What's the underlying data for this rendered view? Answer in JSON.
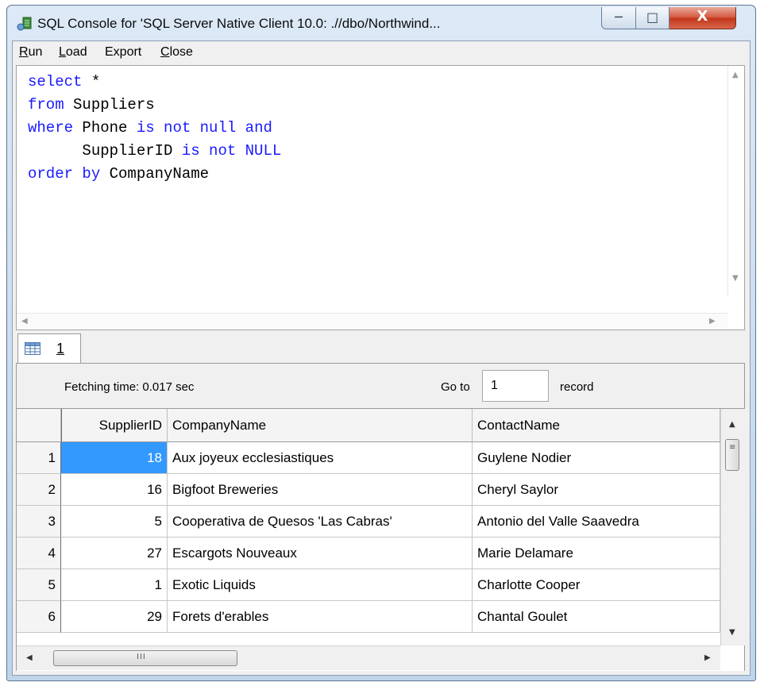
{
  "window": {
    "title": "SQL Console for 'SQL Server Native Client 10.0: .//dbo/Northwind...",
    "min_glyph": "─",
    "max_glyph": "□",
    "close_glyph": "X"
  },
  "menu": {
    "run": "Run",
    "load": "Load",
    "export": "Export",
    "close": "Close"
  },
  "editor": {
    "lines": [
      [
        {
          "t": "select",
          "k": true
        },
        {
          "t": " *",
          "k": false
        }
      ],
      [
        {
          "t": "from",
          "k": true
        },
        {
          "t": " Suppliers",
          "k": false
        }
      ],
      [
        {
          "t": "where",
          "k": true
        },
        {
          "t": " Phone ",
          "k": false
        },
        {
          "t": "is not null and",
          "k": true
        }
      ],
      [
        {
          "t": "      SupplierID ",
          "k": false
        },
        {
          "t": "is not NULL",
          "k": true
        }
      ],
      [
        {
          "t": "order by",
          "k": true
        },
        {
          "t": " CompanyName",
          "k": false
        }
      ]
    ]
  },
  "results": {
    "tab_label": "1",
    "fetching_time": "Fetching time: 0.017 sec",
    "goto_label": "Go to",
    "goto_value": "1",
    "record_label": "record",
    "columns": [
      "SupplierID",
      "CompanyName",
      "ContactName"
    ],
    "rows": [
      {
        "num": "1",
        "id": "18",
        "company": "Aux joyeux ecclesiastiques",
        "contact": "Guylene Nodier"
      },
      {
        "num": "2",
        "id": "16",
        "company": "Bigfoot Breweries",
        "contact": "Cheryl Saylor"
      },
      {
        "num": "3",
        "id": "5",
        "company": "Cooperativa de Quesos 'Las Cabras'",
        "contact": "Antonio del Valle Saavedra"
      },
      {
        "num": "4",
        "id": "27",
        "company": "Escargots Nouveaux",
        "contact": "Marie Delamare"
      },
      {
        "num": "5",
        "id": "1",
        "company": "Exotic Liquids",
        "contact": "Charlotte Cooper"
      },
      {
        "num": "6",
        "id": "29",
        "company": "Forets d'erables",
        "contact": "Chantal Goulet"
      }
    ],
    "selected_row": 0
  },
  "colors": {
    "keyword": "#1a1aff",
    "selection": "#3399ff"
  }
}
